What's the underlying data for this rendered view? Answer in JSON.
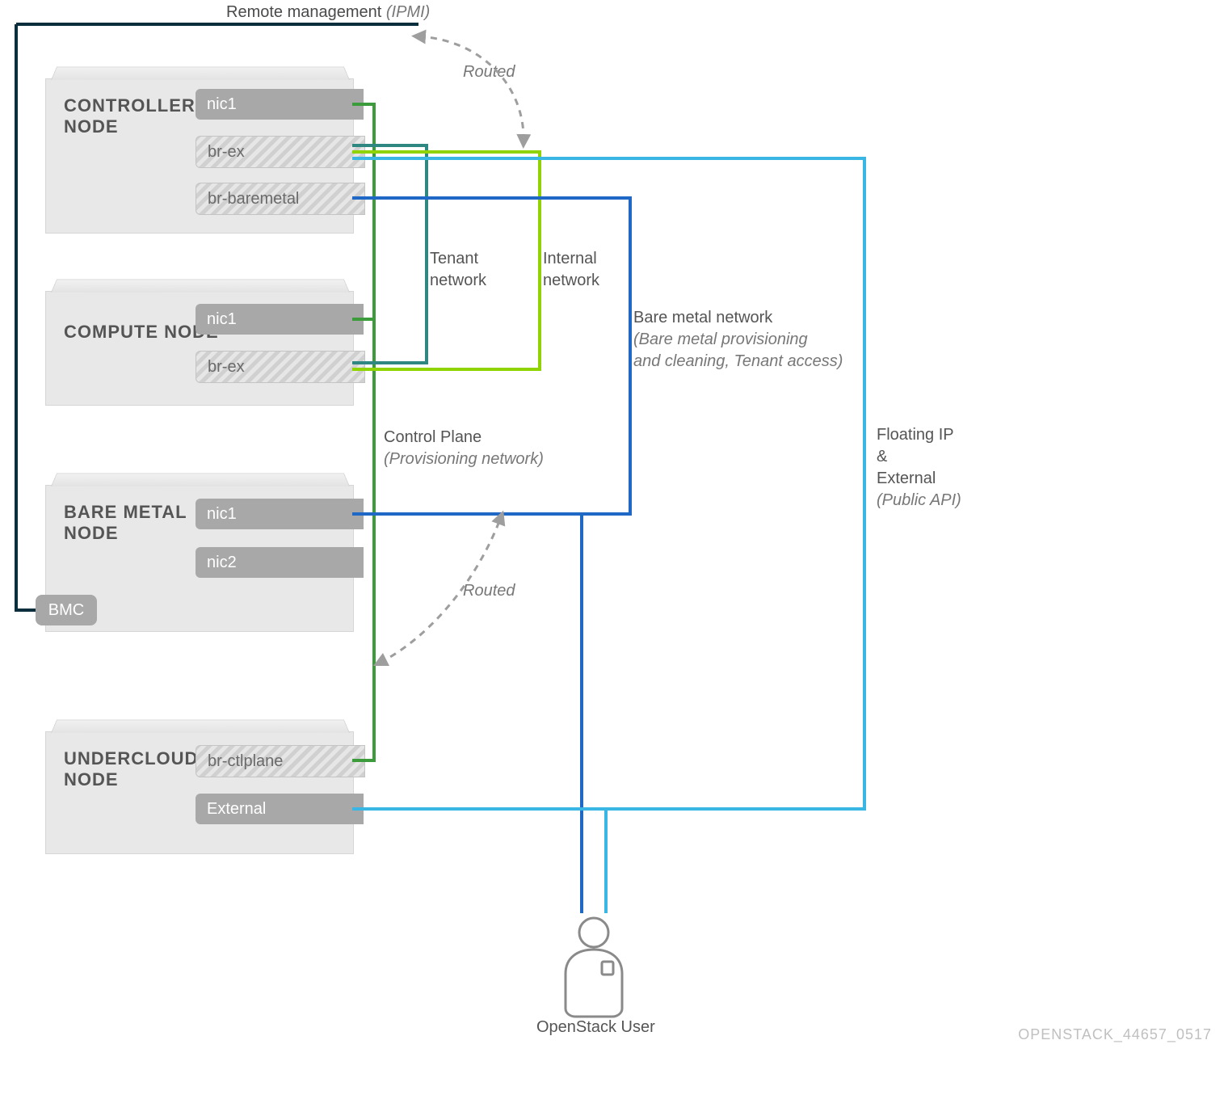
{
  "remote_mgmt": {
    "text": "Remote management",
    "suffix": "(IPMI)"
  },
  "nodes": {
    "controller": {
      "title": "CONTROLLER\nNODE",
      "nic1": "nic1",
      "brex": "br-ex",
      "brbare": "br-baremetal"
    },
    "compute": {
      "title": "COMPUTE NODE",
      "nic1": "nic1",
      "brex": "br-ex"
    },
    "baremetal": {
      "title": "BARE METAL\nNODE",
      "nic1": "nic1",
      "nic2": "nic2",
      "bmc": "BMC"
    },
    "undercloud": {
      "title": "UNDERCLOUD\nNODE",
      "brctl": "br-ctlplane",
      "external": "External"
    }
  },
  "labels": {
    "routed1": "Routed",
    "routed2": "Routed",
    "tenant": "Tenant\nnetwork",
    "internal": "Internal\nnetwork",
    "baremetal_net": {
      "title": "Bare metal network",
      "sub": "(Bare metal provisioning\nand cleaning, Tenant access)"
    },
    "control_plane": {
      "title": "Control Plane",
      "sub": "(Provisioning network)"
    },
    "floating": {
      "title": "Floating IP\n&\nExternal",
      "sub": "(Public API)"
    },
    "user": "OpenStack User"
  },
  "footer": "OPENSTACK_44657_0517",
  "colors": {
    "navy": "#0b2e3d",
    "teal": "#2f8782",
    "lime": "#8fd400",
    "blue": "#1f68c6",
    "cyan": "#39b6e3",
    "green": "#3c9c3c"
  }
}
